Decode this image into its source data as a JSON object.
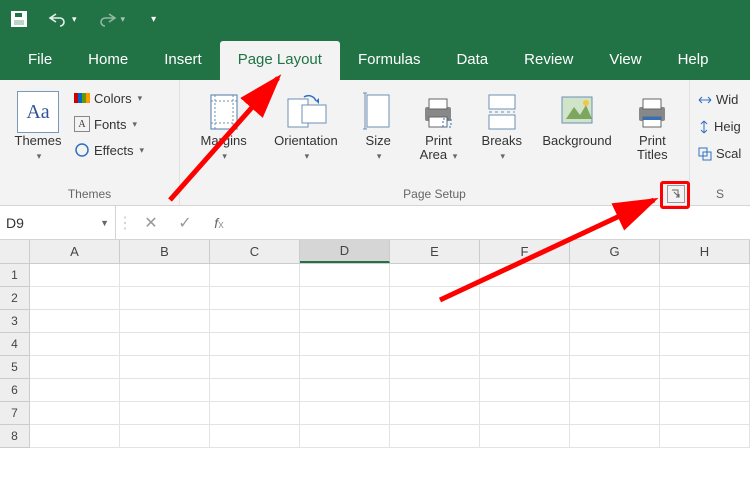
{
  "qa": {
    "save": "save-icon",
    "undo": "undo-icon",
    "redo": "redo-icon"
  },
  "tabs": [
    "File",
    "Home",
    "Insert",
    "Page Layout",
    "Formulas",
    "Data",
    "Review",
    "View",
    "Help"
  ],
  "active_tab": "Page Layout",
  "ribbon": {
    "themes": {
      "label": "Themes",
      "big": "Themes",
      "colors": "Colors",
      "fonts": "Fonts",
      "effects": "Effects"
    },
    "page_setup": {
      "label": "Page Setup",
      "margins": "Margins",
      "orientation": "Orientation",
      "size": "Size",
      "print_area": "Print\nArea",
      "breaks": "Breaks",
      "background": "Background",
      "print_titles": "Print\nTitles"
    },
    "scale_to_fit": {
      "label": "S",
      "width": "Wid",
      "height": "Heig",
      "scale": "Scal"
    }
  },
  "name_box": "D9",
  "columns": [
    "A",
    "B",
    "C",
    "D",
    "E",
    "F",
    "G",
    "H"
  ],
  "rows": [
    1,
    2,
    3,
    4,
    5,
    6,
    7,
    8
  ]
}
